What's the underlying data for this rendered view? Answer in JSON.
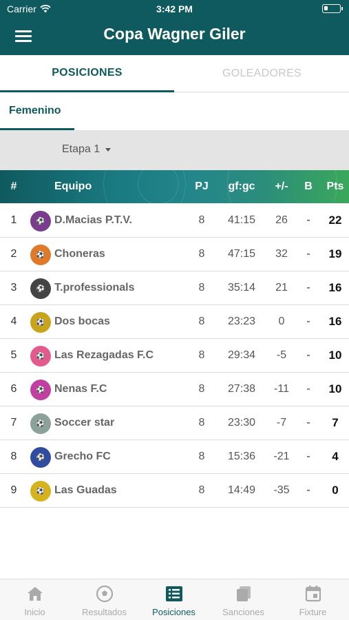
{
  "status": {
    "carrier": "Carrier",
    "time": "3:42 PM"
  },
  "header": {
    "title": "Copa Wagner Giler",
    "menu_icon": "hamburger-icon"
  },
  "tabs": [
    {
      "label": "POSICIONES",
      "active": true
    },
    {
      "label": "GOLEADORES",
      "active": false
    }
  ],
  "subtab": {
    "label": "Femenino"
  },
  "stage": {
    "label": "Etapa 1"
  },
  "table": {
    "headers": {
      "pos": "#",
      "team": "Equipo",
      "pj": "PJ",
      "gfgc": "gf:gc",
      "diff": "+/-",
      "b": "B",
      "pts": "Pts"
    },
    "rows": [
      {
        "pos": "1",
        "team": "D.Macias P.T.V.",
        "pj": "8",
        "gfgc": "41:15",
        "diff": "26",
        "b": "-",
        "pts": "22",
        "logo_color": "#7a3c8c"
      },
      {
        "pos": "2",
        "team": "Choneras",
        "pj": "8",
        "gfgc": "47:15",
        "diff": "32",
        "b": "-",
        "pts": "19",
        "logo_color": "#e07a2b"
      },
      {
        "pos": "3",
        "team": "T.professionals",
        "pj": "8",
        "gfgc": "35:14",
        "diff": "21",
        "b": "-",
        "pts": "16",
        "logo_color": "#444444"
      },
      {
        "pos": "4",
        "team": "Dos bocas",
        "pj": "8",
        "gfgc": "23:23",
        "diff": "0",
        "b": "-",
        "pts": "16",
        "logo_color": "#c9a319"
      },
      {
        "pos": "5",
        "team": "Las Rezagadas F.C",
        "pj": "8",
        "gfgc": "29:34",
        "diff": "-5",
        "b": "-",
        "pts": "10",
        "logo_color": "#e35b8c"
      },
      {
        "pos": "6",
        "team": "Nenas F.C",
        "pj": "8",
        "gfgc": "27:38",
        "diff": "-11",
        "b": "-",
        "pts": "10",
        "logo_color": "#c13fa0"
      },
      {
        "pos": "7",
        "team": "Soccer star",
        "pj": "8",
        "gfgc": "23:30",
        "diff": "-7",
        "b": "-",
        "pts": "7",
        "logo_color": "#8aa29a"
      },
      {
        "pos": "8",
        "team": "Grecho FC",
        "pj": "8",
        "gfgc": "15:36",
        "diff": "-21",
        "b": "-",
        "pts": "4",
        "logo_color": "#2f4ca0"
      },
      {
        "pos": "9",
        "team": "Las Guadas",
        "pj": "8",
        "gfgc": "14:49",
        "diff": "-35",
        "b": "-",
        "pts": "0",
        "logo_color": "#d6b21c"
      }
    ]
  },
  "bottom_nav": [
    {
      "label": "Inicio",
      "icon": "home-icon",
      "active": false
    },
    {
      "label": "Resultados",
      "icon": "soccer-ball-icon",
      "active": false
    },
    {
      "label": "Posiciones",
      "icon": "list-icon",
      "active": true
    },
    {
      "label": "Sanciones",
      "icon": "cards-icon",
      "active": false
    },
    {
      "label": "Fixture",
      "icon": "calendar-icon",
      "active": false
    }
  ],
  "colors": {
    "primary": "#0f5a5e",
    "accent_green": "#3aa85a",
    "inactive": "#aaaaaa"
  }
}
